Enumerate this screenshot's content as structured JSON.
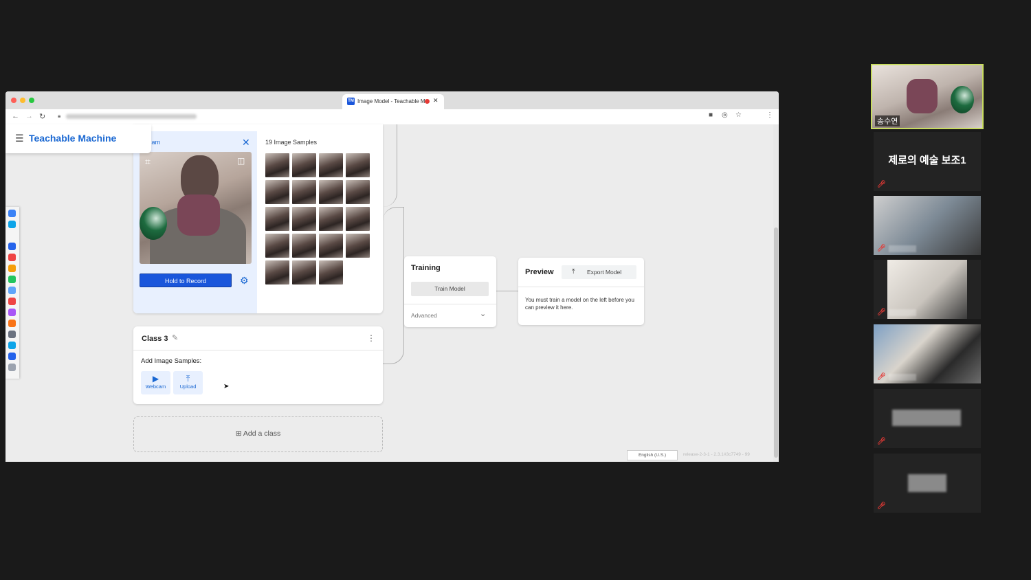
{
  "browser": {
    "tab_title": "Image Model - Teachable M",
    "tab_favicon": "TM"
  },
  "app": {
    "brand": "Teachable Machine"
  },
  "class_card": {
    "webcam_label": "cam",
    "record_button": "Hold to Record",
    "samples_title": "19 Image Samples",
    "sample_count": 19
  },
  "class3": {
    "title": "Class 3",
    "add_samples_label": "Add Image Samples:",
    "webcam_label": "Webcam",
    "upload_label": "Upload"
  },
  "add_class": {
    "label": "Add a class"
  },
  "training": {
    "title": "Training",
    "train_button": "Train Model",
    "advanced_label": "Advanced"
  },
  "preview": {
    "title": "Preview",
    "export_button": "Export Model",
    "message": "You must train a model on the left before you can preview it here."
  },
  "footer": {
    "language": "English (U.S.)",
    "version": "release-2-3-1 - 2.3.1#3c7749 - 99"
  },
  "participants": {
    "active_name": "송수연",
    "text_tile": "제로의 예술 보조1"
  },
  "colors": {
    "accent": "#1a56db",
    "active_border": "#c8dc60",
    "muted": "#e53935"
  }
}
